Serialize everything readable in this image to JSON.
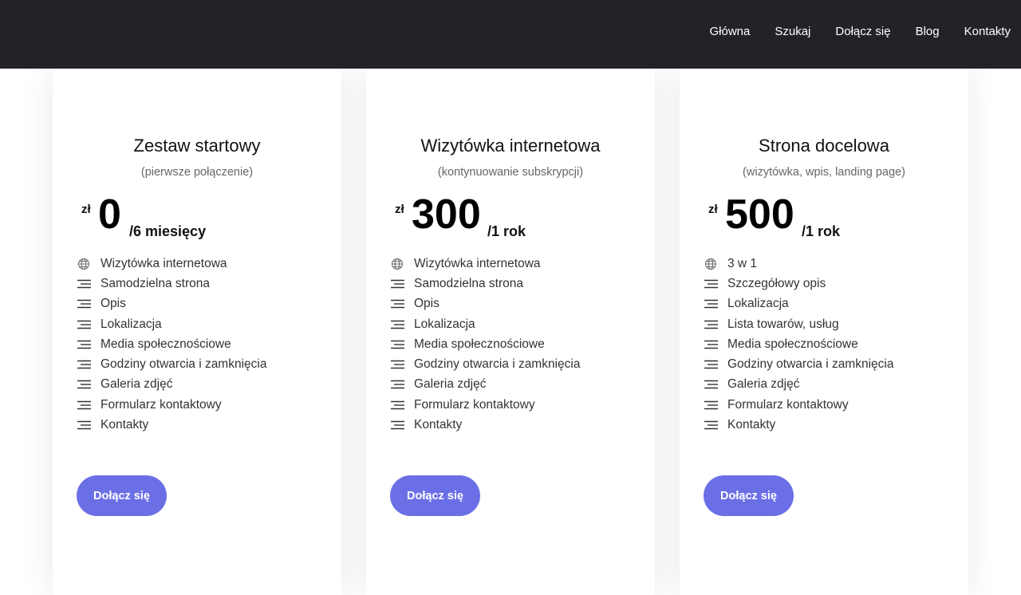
{
  "nav": {
    "items": [
      "Główna",
      "Szukaj",
      "Dołącz się",
      "Blog",
      "Kontakty"
    ]
  },
  "colors": {
    "topbar": "#222326",
    "button": "#6b6fe6"
  },
  "plans": [
    {
      "title": "Zestaw startowy",
      "subtitle": "(pierwsze połączenie)",
      "currency": "zł",
      "amount": "0",
      "period": "/6 miesięcy",
      "features": [
        {
          "icon": "globe-icon",
          "label": "Wizytówka internetowa"
        },
        {
          "icon": "lines-icon",
          "label": "Samodzielna strona"
        },
        {
          "icon": "lines-icon",
          "label": "Opis"
        },
        {
          "icon": "lines-icon",
          "label": "Lokalizacja"
        },
        {
          "icon": "lines-icon",
          "label": "Media społecznościowe"
        },
        {
          "icon": "lines-icon",
          "label": "Godziny otwarcia i zamknięcia"
        },
        {
          "icon": "lines-icon",
          "label": "Galeria zdjęć"
        },
        {
          "icon": "lines-icon",
          "label": "Formularz kontaktowy"
        },
        {
          "icon": "lines-icon",
          "label": "Kontakty"
        }
      ],
      "button": "Dołącz się"
    },
    {
      "title": "Wizytówka internetowa",
      "subtitle": "(kontynuowanie subskrypcji)",
      "currency": "zł",
      "amount": "300",
      "period": "/1 rok",
      "features": [
        {
          "icon": "globe-icon",
          "label": "Wizytówka internetowa"
        },
        {
          "icon": "lines-icon",
          "label": "Samodzielna strona"
        },
        {
          "icon": "lines-icon",
          "label": "Opis"
        },
        {
          "icon": "lines-icon",
          "label": "Lokalizacja"
        },
        {
          "icon": "lines-icon",
          "label": "Media społecznościowe"
        },
        {
          "icon": "lines-icon",
          "label": "Godziny otwarcia i zamknięcia"
        },
        {
          "icon": "lines-icon",
          "label": "Galeria zdjęć"
        },
        {
          "icon": "lines-icon",
          "label": "Formularz kontaktowy"
        },
        {
          "icon": "lines-icon",
          "label": "Kontakty"
        }
      ],
      "button": "Dołącz się"
    },
    {
      "title": "Strona docelowa",
      "subtitle": "(wizytówka, wpis, landing page)",
      "currency": "zł",
      "amount": "500",
      "period": "/1 rok",
      "features": [
        {
          "icon": "globe-icon",
          "label": "3 w 1"
        },
        {
          "icon": "lines-icon",
          "label": "Szczegółowy opis"
        },
        {
          "icon": "lines-icon",
          "label": "Lokalizacja"
        },
        {
          "icon": "lines-icon",
          "label": "Lista towarów, usług"
        },
        {
          "icon": "lines-icon",
          "label": "Media społecznościowe"
        },
        {
          "icon": "lines-icon",
          "label": "Godziny otwarcia i zamknięcia"
        },
        {
          "icon": "lines-icon",
          "label": "Galeria zdjęć"
        },
        {
          "icon": "lines-icon",
          "label": "Formularz kontaktowy"
        },
        {
          "icon": "lines-icon",
          "label": "Kontakty"
        }
      ],
      "button": "Dołącz się"
    }
  ]
}
